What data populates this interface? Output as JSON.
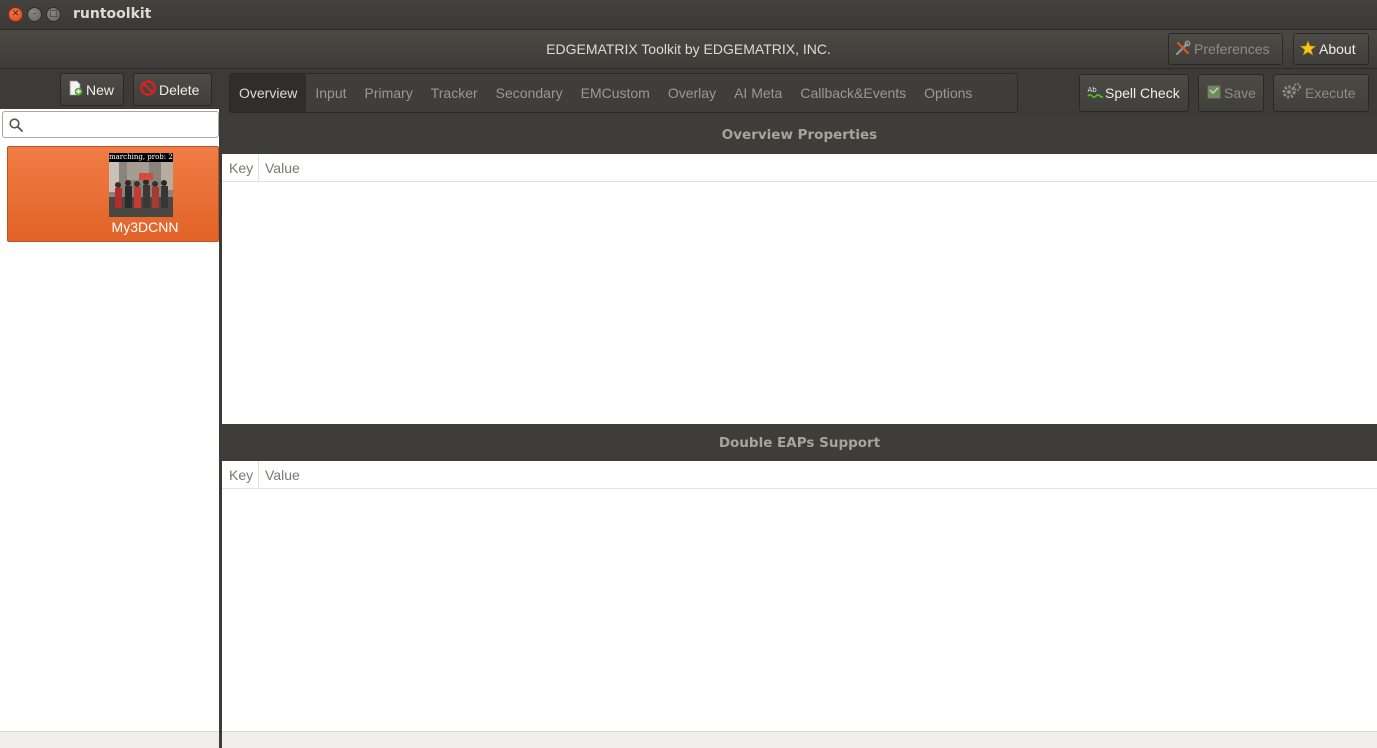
{
  "window": {
    "app_title": "runtoolkit"
  },
  "header": {
    "title": "EDGEMATRIX Toolkit by EDGEMATRIX, INC.",
    "preferences_label": "Preferences",
    "about_label": "About"
  },
  "sidebar": {
    "new_label": "New",
    "delete_label": "Delete",
    "search_placeholder": "",
    "items": [
      {
        "label": "My3DCNN",
        "thumbnail_caption": "marching, prob: 21",
        "selected": true
      }
    ]
  },
  "tabs": [
    {
      "label": "Overview",
      "active": true
    },
    {
      "label": "Input",
      "active": false
    },
    {
      "label": "Primary",
      "active": false
    },
    {
      "label": "Tracker",
      "active": false
    },
    {
      "label": "Secondary",
      "active": false
    },
    {
      "label": "EMCustom",
      "active": false
    },
    {
      "label": "Overlay",
      "active": false
    },
    {
      "label": "AI Meta",
      "active": false
    },
    {
      "label": "Callback&Events",
      "active": false
    },
    {
      "label": "Options",
      "active": false
    }
  ],
  "toolbar": {
    "spell_check_label": "Spell Check",
    "save_label": "Save",
    "execute_label": "Execute"
  },
  "sections": [
    {
      "title": "Overview Properties",
      "columns": [
        "Key",
        "Value"
      ],
      "rows": []
    },
    {
      "title": "Double EAPs Support",
      "columns": [
        "Key",
        "Value"
      ],
      "rows": []
    }
  ],
  "colors": {
    "accent": "#e8692e",
    "toolbar_bg": "#3c3b37",
    "close_button": "#e5552a"
  },
  "icons": {
    "close": "close-icon",
    "minimize": "minimize-icon",
    "maximize": "maximize-icon",
    "preferences": "wrench-screwdriver-icon",
    "about": "star-icon",
    "new": "new-document-icon",
    "delete": "no-entry-icon",
    "search": "search-icon",
    "spell_check": "spell-check-icon",
    "save": "save-icon",
    "execute": "gear-icon"
  }
}
